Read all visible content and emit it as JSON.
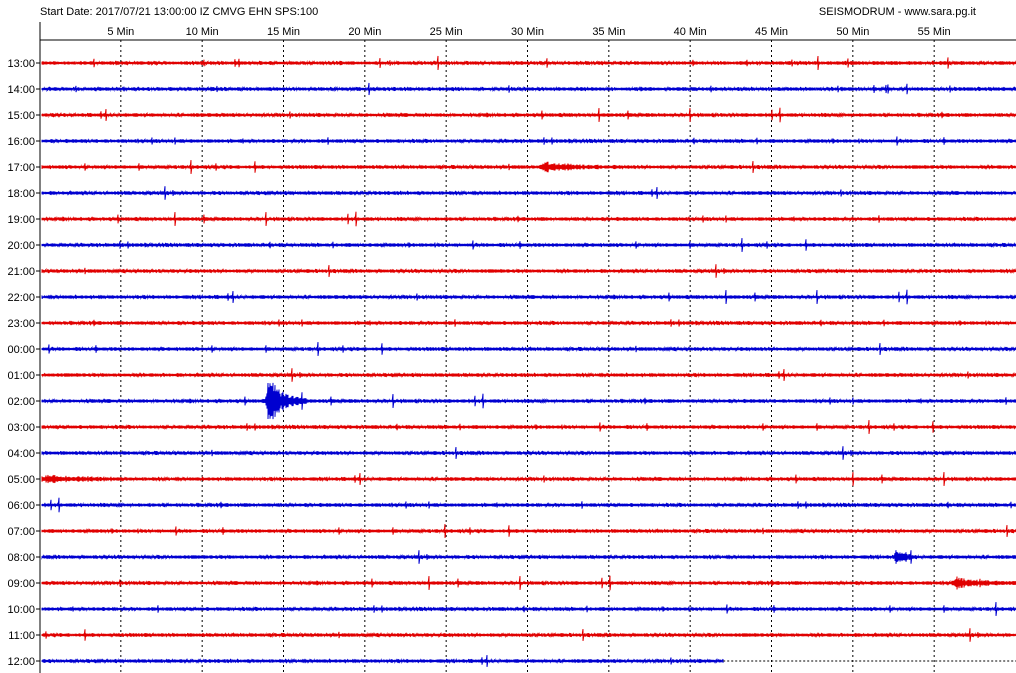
{
  "header": {
    "start_info": "Start Date: 2017/07/21 13:00:00 IZ CMVG EHN SPS:100",
    "site": "SEISMODRUM - www.sara.pg.it"
  },
  "colors": {
    "odd_trace": "#e00000",
    "even_trace": "#0000d0",
    "grid": "#000000"
  },
  "chart_data": {
    "type": "line",
    "title": "",
    "xlabel": "",
    "ylabel": "",
    "minute_ticks": [
      "5 Min",
      "10 Min",
      "15 Min",
      "20 Min",
      "25 Min",
      "30 Min",
      "35 Min",
      "40 Min",
      "45 Min",
      "50 Min",
      "55 Min"
    ],
    "x_range_minutes": [
      0,
      60
    ],
    "rows": [
      "13:00",
      "14:00",
      "15:00",
      "16:00",
      "17:00",
      "18:00",
      "19:00",
      "20:00",
      "21:00",
      "22:00",
      "23:00",
      "00:00",
      "01:00",
      "02:00",
      "03:00",
      "04:00",
      "05:00",
      "06:00",
      "07:00",
      "08:00",
      "09:00",
      "10:00",
      "11:00",
      "12:00"
    ],
    "last_row_end_minute": 42,
    "events": [
      {
        "row": "02:00",
        "start_minute": 13.8,
        "duration_min": 2.6,
        "amplitude": 22,
        "note": "largest event"
      },
      {
        "row": "17:00",
        "start_minute": 30.5,
        "duration_min": 5.0,
        "amplitude": 4
      },
      {
        "row": "09:00",
        "start_minute": 56.0,
        "duration_min": 4.0,
        "amplitude": 4
      },
      {
        "row": "05:00",
        "start_minute": 0.0,
        "duration_min": 5.0,
        "amplitude": 3
      },
      {
        "row": "08:00",
        "start_minute": 52.5,
        "duration_min": 1.5,
        "amplitude": 6
      }
    ]
  }
}
